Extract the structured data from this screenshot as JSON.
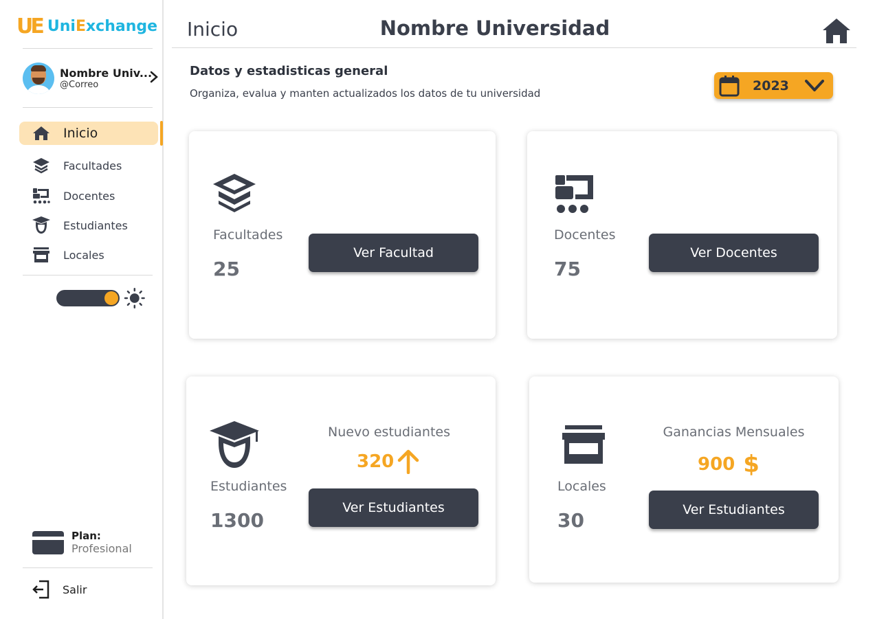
{
  "app": {
    "logo_mark": "UE",
    "logo_text_a": "Uni",
    "logo_text_b": "E",
    "logo_text_c": "xchange",
    "brand_blue": "#1fb5e0",
    "accent": "#f5a623",
    "dark": "#3a3f4b"
  },
  "profile": {
    "name": "Nombre Univ...",
    "email": "@Correo"
  },
  "nav": {
    "items": [
      {
        "label": "Inicio",
        "icon": "home-icon",
        "active": true
      },
      {
        "label": "Facultades",
        "icon": "graduation-cap-icon",
        "active": false
      },
      {
        "label": "Docentes",
        "icon": "teacher-board-icon",
        "active": false
      },
      {
        "label": "Estudiantes",
        "icon": "student-icon",
        "active": false
      },
      {
        "label": "Locales",
        "icon": "store-icon",
        "active": false
      }
    ]
  },
  "theme": {
    "mode": "light",
    "left_icon": "moon-icon",
    "right_icon": "sun-icon"
  },
  "plan": {
    "label": "Plan:",
    "value": "Profesional"
  },
  "logout": {
    "label": "Salir"
  },
  "header": {
    "title": "Inicio",
    "university": "Nombre Universidad",
    "home_icon": "home-icon"
  },
  "section": {
    "title": "Datos y estadisticas general",
    "subtitle": "Organiza, evalua y manten actualizados los datos de tu universidad"
  },
  "year_select": {
    "value": "2023",
    "icon": "calendar-icon"
  },
  "cards": {
    "facultades": {
      "label": "Facultades",
      "count": "25",
      "button": "Ver Facultad"
    },
    "docentes": {
      "label": "Docentes",
      "count": "75",
      "button": "Ver Docentes"
    },
    "estudiantes": {
      "label": "Estudiantes",
      "count": "1300",
      "button": "Ver Estudiantes",
      "stat_title": "Nuevo estudiantes",
      "stat_value": "320"
    },
    "locales": {
      "label": "Locales",
      "count": "30",
      "button": "Ver Estudiantes",
      "stat_title": "Ganancias Mensuales",
      "stat_value": "900",
      "stat_currency": "$"
    }
  }
}
